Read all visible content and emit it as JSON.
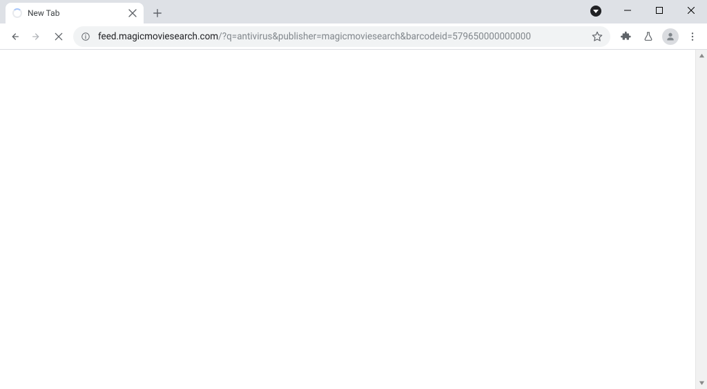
{
  "tab": {
    "title": "New Tab"
  },
  "url": {
    "host": "feed.magicmoviesearch.com",
    "rest": "/?q=antivirus&publisher=magicmoviesearch&barcodeid=579650000000000"
  }
}
